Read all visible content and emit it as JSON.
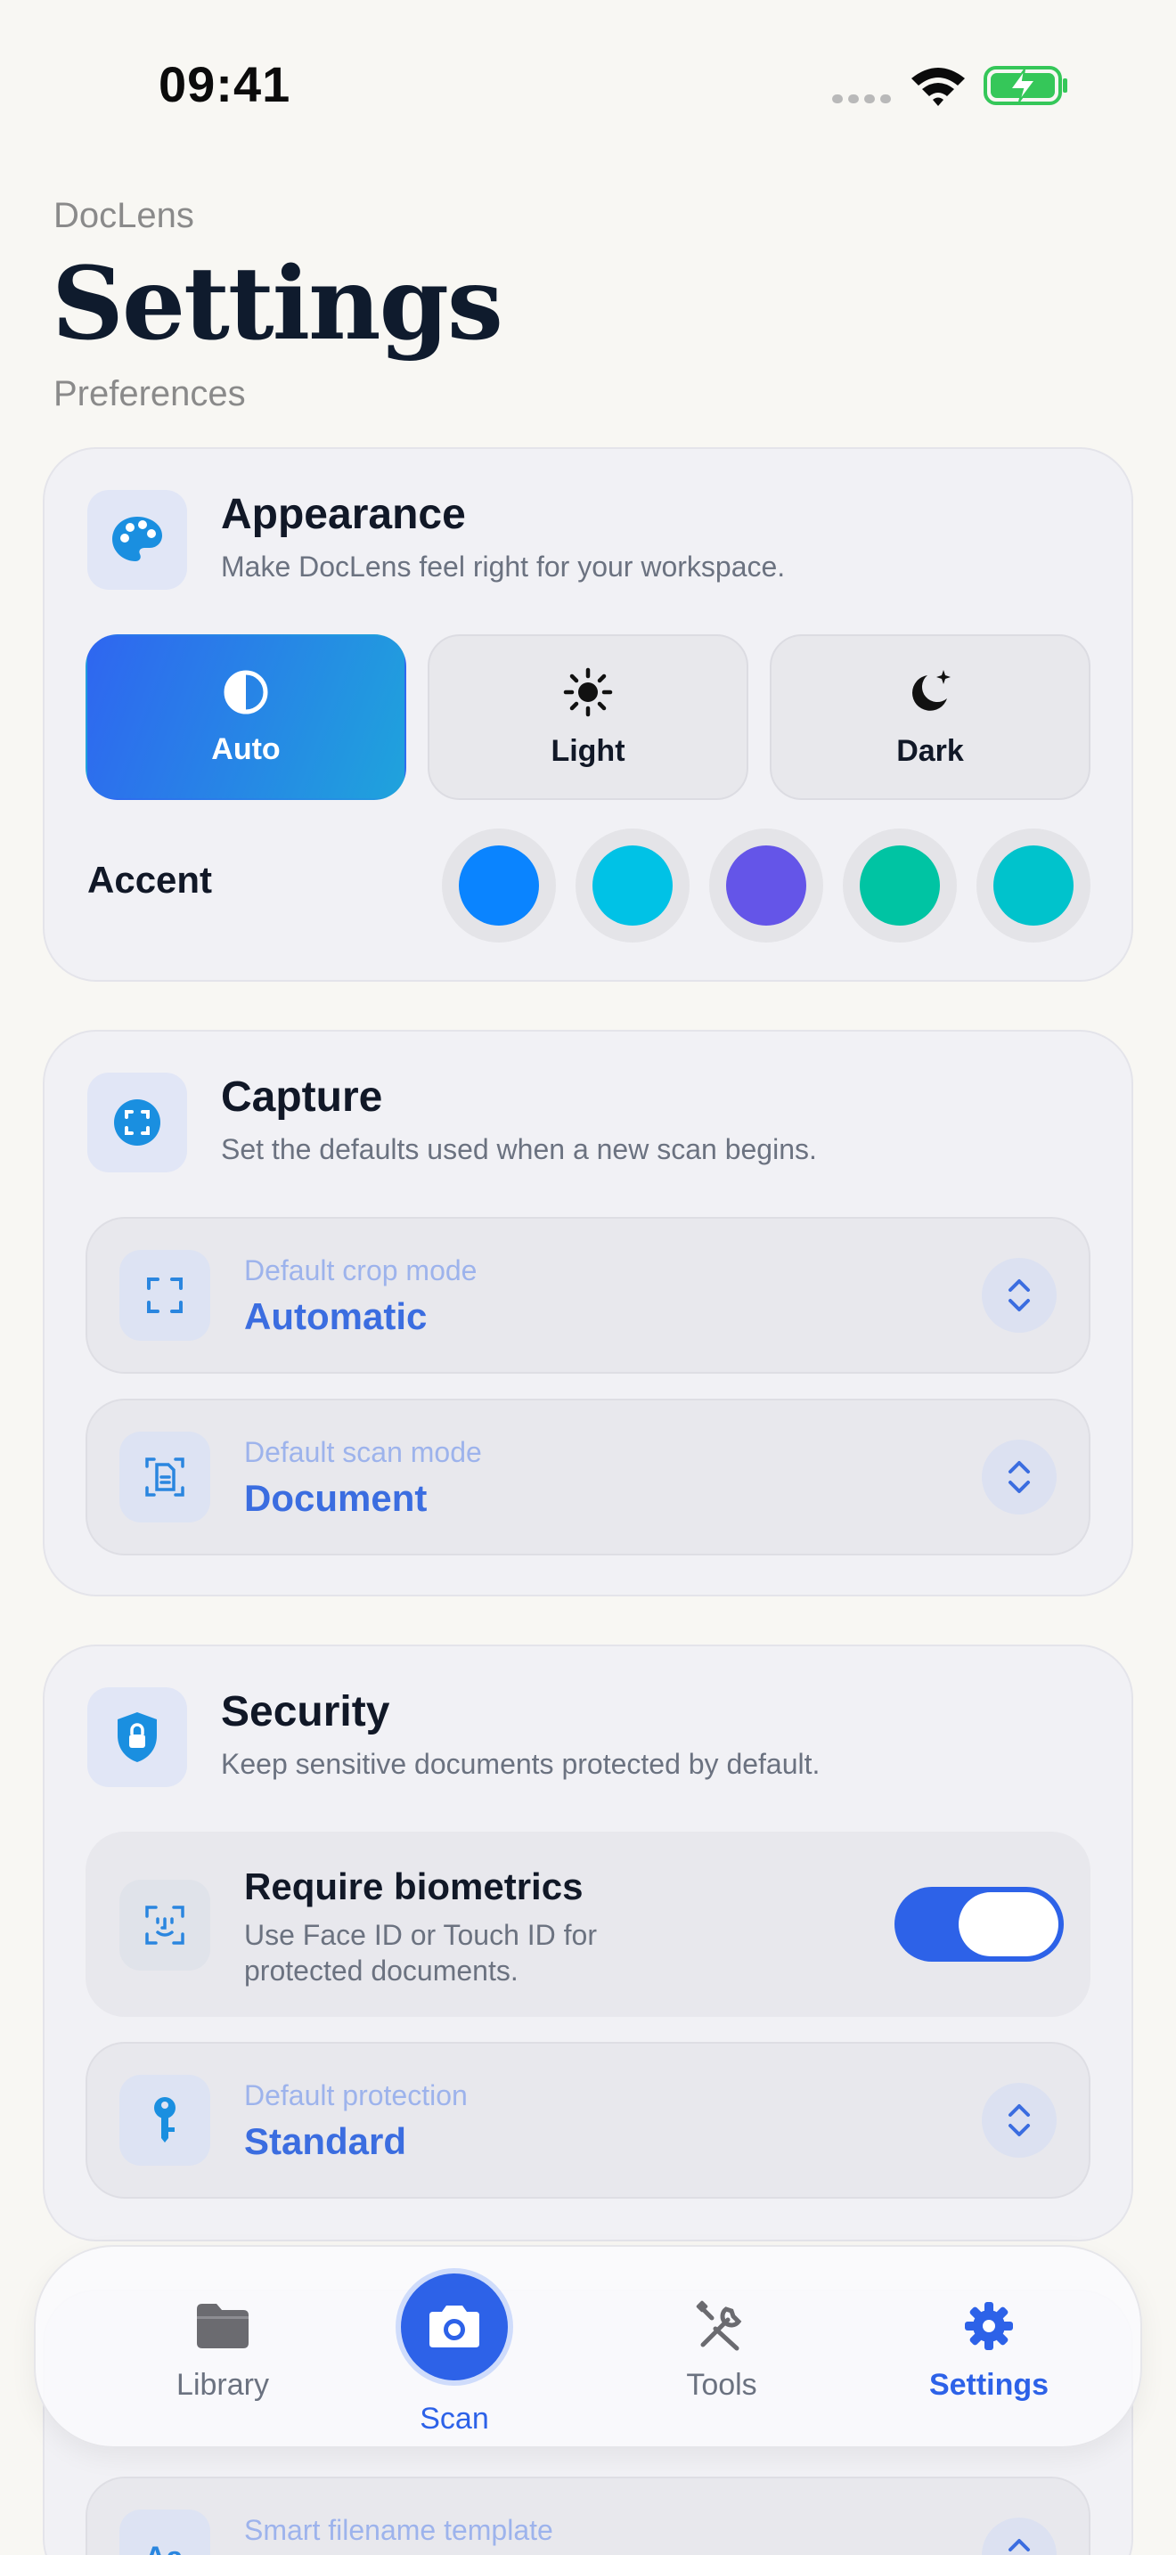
{
  "status_bar": {
    "time": "09:41"
  },
  "header": {
    "app_name": "DocLens",
    "title": "Settings",
    "subtitle": "Preferences"
  },
  "appearance": {
    "title": "Appearance",
    "description": "Make DocLens feel right for your workspace.",
    "modes": [
      {
        "label": "Auto",
        "icon": "half-circle-icon",
        "selected": true
      },
      {
        "label": "Light",
        "icon": "sun-icon",
        "selected": false
      },
      {
        "label": "Dark",
        "icon": "moon-stars-icon",
        "selected": false
      }
    ],
    "accent_label": "Accent",
    "accent_colors": [
      "#0a84ff",
      "#00c2e6",
      "#6455e8",
      "#00c4a3",
      "#00c3cc"
    ]
  },
  "capture": {
    "title": "Capture",
    "description": "Set the defaults used when a new scan begins.",
    "crop_mode": {
      "label": "Default crop mode",
      "value": "Automatic",
      "icon": "crop-frame-icon"
    },
    "scan_mode": {
      "label": "Default scan mode",
      "value": "Document",
      "icon": "document-scan-icon"
    }
  },
  "security": {
    "title": "Security",
    "description": "Keep sensitive documents protected by default.",
    "biometrics": {
      "title": "Require biometrics",
      "description": "Use Face ID or Touch ID for protected documents.",
      "enabled": true,
      "icon": "face-id-icon"
    },
    "protection": {
      "label": "Default protection",
      "value": "Standard",
      "icon": "key-icon"
    }
  },
  "document_processing": {
    "smart_filename": {
      "label": "Smart filename template"
    }
  },
  "tab_bar": {
    "tabs": [
      {
        "label": "Library",
        "icon": "folder-icon",
        "active": false
      },
      {
        "label": "Scan",
        "icon": "camera-icon",
        "active": false
      },
      {
        "label": "Tools",
        "icon": "tools-icon",
        "active": false
      },
      {
        "label": "Settings",
        "icon": "gear-icon",
        "active": true
      }
    ]
  },
  "colors": {
    "accent": "#2d62e8",
    "background": "#f8f7f3",
    "card": "#f1f1f5"
  }
}
